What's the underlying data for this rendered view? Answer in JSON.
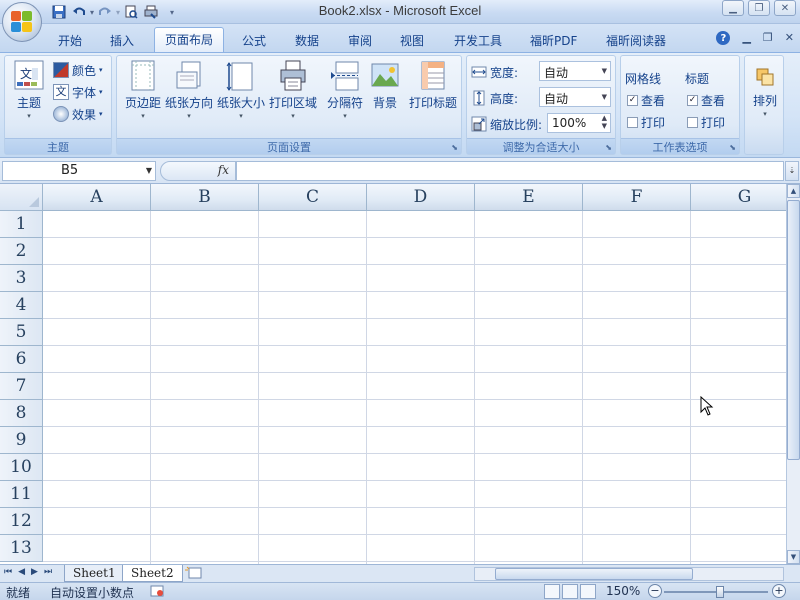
{
  "window": {
    "title": "Book2.xlsx - Microsoft Excel"
  },
  "quick_access": {
    "save_icon": "save-icon",
    "undo_icon": "undo-icon",
    "redo_icon": "redo-icon",
    "print_preview_icon": "print-preview-icon",
    "customize_icon": "customize-toolbar-icon"
  },
  "tabs": [
    {
      "label": "开始",
      "active": false
    },
    {
      "label": "插入",
      "active": false
    },
    {
      "label": "页面布局",
      "active": true
    },
    {
      "label": "公式",
      "active": false
    },
    {
      "label": "数据",
      "active": false
    },
    {
      "label": "审阅",
      "active": false
    },
    {
      "label": "视图",
      "active": false
    },
    {
      "label": "开发工具",
      "active": false
    },
    {
      "label": "福昕PDF",
      "active": false
    },
    {
      "label": "福昕阅读器",
      "active": false
    }
  ],
  "ribbon": {
    "themes_group": {
      "label": "主题",
      "themes_btn": "主题",
      "colors_btn": "颜色",
      "fonts_btn": "字体",
      "effects_btn": "效果",
      "fonts_icon_text": "文"
    },
    "page_setup_group": {
      "label": "页面设置",
      "margins": "页边距",
      "orientation": "纸张方向",
      "size": "纸张大小",
      "print_area": "打印区域",
      "breaks": "分隔符",
      "background": "背景",
      "print_titles": "打印标题"
    },
    "scale_group": {
      "label": "调整为合适大小",
      "width_label": "宽度:",
      "width_value": "自动",
      "height_label": "高度:",
      "height_value": "自动",
      "scale_label": "缩放比例:",
      "scale_value": "100%"
    },
    "sheet_options_group": {
      "label": "工作表选项",
      "gridlines_header": "网格线",
      "headings_header": "标题",
      "view_label": "查看",
      "print_label": "打印",
      "gridlines_view_checked": true,
      "gridlines_print_checked": false,
      "headings_view_checked": true,
      "headings_print_checked": false
    },
    "arrange_group": {
      "label": "排列"
    }
  },
  "formula_bar": {
    "name_box": "B5",
    "fx": "fx",
    "formula": ""
  },
  "grid": {
    "columns": [
      "A",
      "B",
      "C",
      "D",
      "E",
      "F",
      "G"
    ],
    "rows": [
      "1",
      "2",
      "3",
      "4",
      "5",
      "6",
      "7",
      "8",
      "9",
      "10",
      "11",
      "12",
      "13"
    ]
  },
  "sheets": {
    "tabs": [
      {
        "label": "Sheet1",
        "active": false
      },
      {
        "label": "Sheet2",
        "active": true
      }
    ]
  },
  "status_bar": {
    "ready": "就绪",
    "auto_decimal": "自动设置小数点",
    "zoom": "150%",
    "zoom_minus": "−",
    "zoom_plus": "+"
  },
  "colors": {
    "accent": "#15428b",
    "ribbon_bg": "#d4e4f7",
    "gridline": "#d0d7e5"
  }
}
